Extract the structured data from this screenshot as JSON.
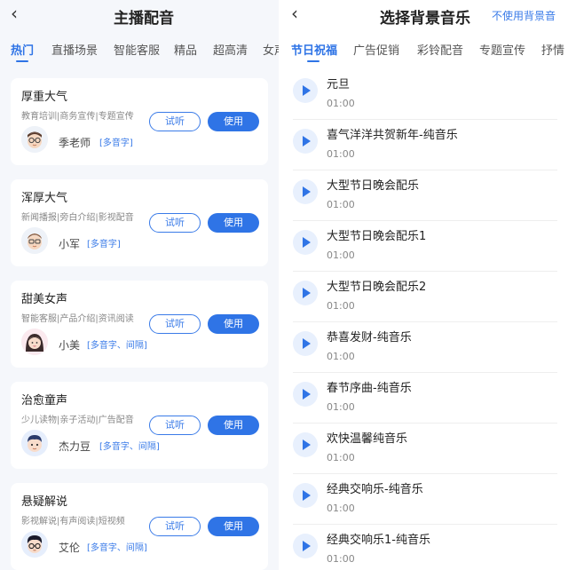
{
  "left": {
    "title": "主播配音",
    "back_icon": "‹",
    "tabs": [
      {
        "label": "热门",
        "active": true
      },
      {
        "label": "直播场景"
      },
      {
        "label": "智能客服"
      },
      {
        "label": "精品"
      },
      {
        "label": "超高清"
      },
      {
        "label": "女声"
      }
    ],
    "buttons": {
      "try_label": "试听",
      "use_label": "使用"
    },
    "voices": [
      {
        "title": "厚重大气",
        "tags": "教育培训|商务宣传|专题宣传",
        "name": "季老师",
        "features": "[多音字]",
        "avatar": "man-glasses-icon"
      },
      {
        "title": "浑厚大气",
        "tags": "新闻播报|旁白介绍|影视配音",
        "name": "小军",
        "features": "[多音字]",
        "avatar": "man-glasses-icon"
      },
      {
        "title": "甜美女声",
        "tags": "智能客服|产品介绍|资讯阅读",
        "name": "小美",
        "features": "[多音字、间隔]",
        "avatar": "woman-icon"
      },
      {
        "title": "治愈童声",
        "tags": "少儿读物|亲子活动|广告配音",
        "name": "杰力豆",
        "features": "[多音字、间隔]",
        "avatar": "boy-icon"
      },
      {
        "title": "悬疑解说",
        "tags": "影视解说|有声阅读|短视频",
        "name": "艾伦",
        "features": "[多音字、间隔]",
        "avatar": "young-man-glasses-icon"
      }
    ]
  },
  "right": {
    "title": "选择背景音乐",
    "back_icon": "‹",
    "no_bgm_label": "不使用背景音",
    "tabs": [
      {
        "label": "节日祝福",
        "active": true
      },
      {
        "label": "广告促销"
      },
      {
        "label": "彩铃配音"
      },
      {
        "label": "专题宣传"
      },
      {
        "label": "抒情"
      }
    ],
    "songs": [
      {
        "name": "元旦",
        "duration": "01:00"
      },
      {
        "name": "喜气洋洋共贺新年-纯音乐",
        "duration": "01:00"
      },
      {
        "name": "大型节日晚会配乐",
        "duration": "01:00"
      },
      {
        "name": "大型节日晚会配乐1",
        "duration": "01:00"
      },
      {
        "name": "大型节日晚会配乐2",
        "duration": "01:00"
      },
      {
        "name": "恭喜发财-纯音乐",
        "duration": "01:00"
      },
      {
        "name": "春节序曲-纯音乐",
        "duration": "01:00"
      },
      {
        "name": "欢快温馨纯音乐",
        "duration": "01:00"
      },
      {
        "name": "经典交响乐-纯音乐",
        "duration": "01:00"
      },
      {
        "name": "经典交响乐1-纯音乐",
        "duration": "01:00"
      }
    ]
  },
  "colors": {
    "accent": "#2f74e6",
    "link": "#3a7be8",
    "left_bg": "#f5f7fb",
    "play_bg": "#e8f0fd"
  }
}
